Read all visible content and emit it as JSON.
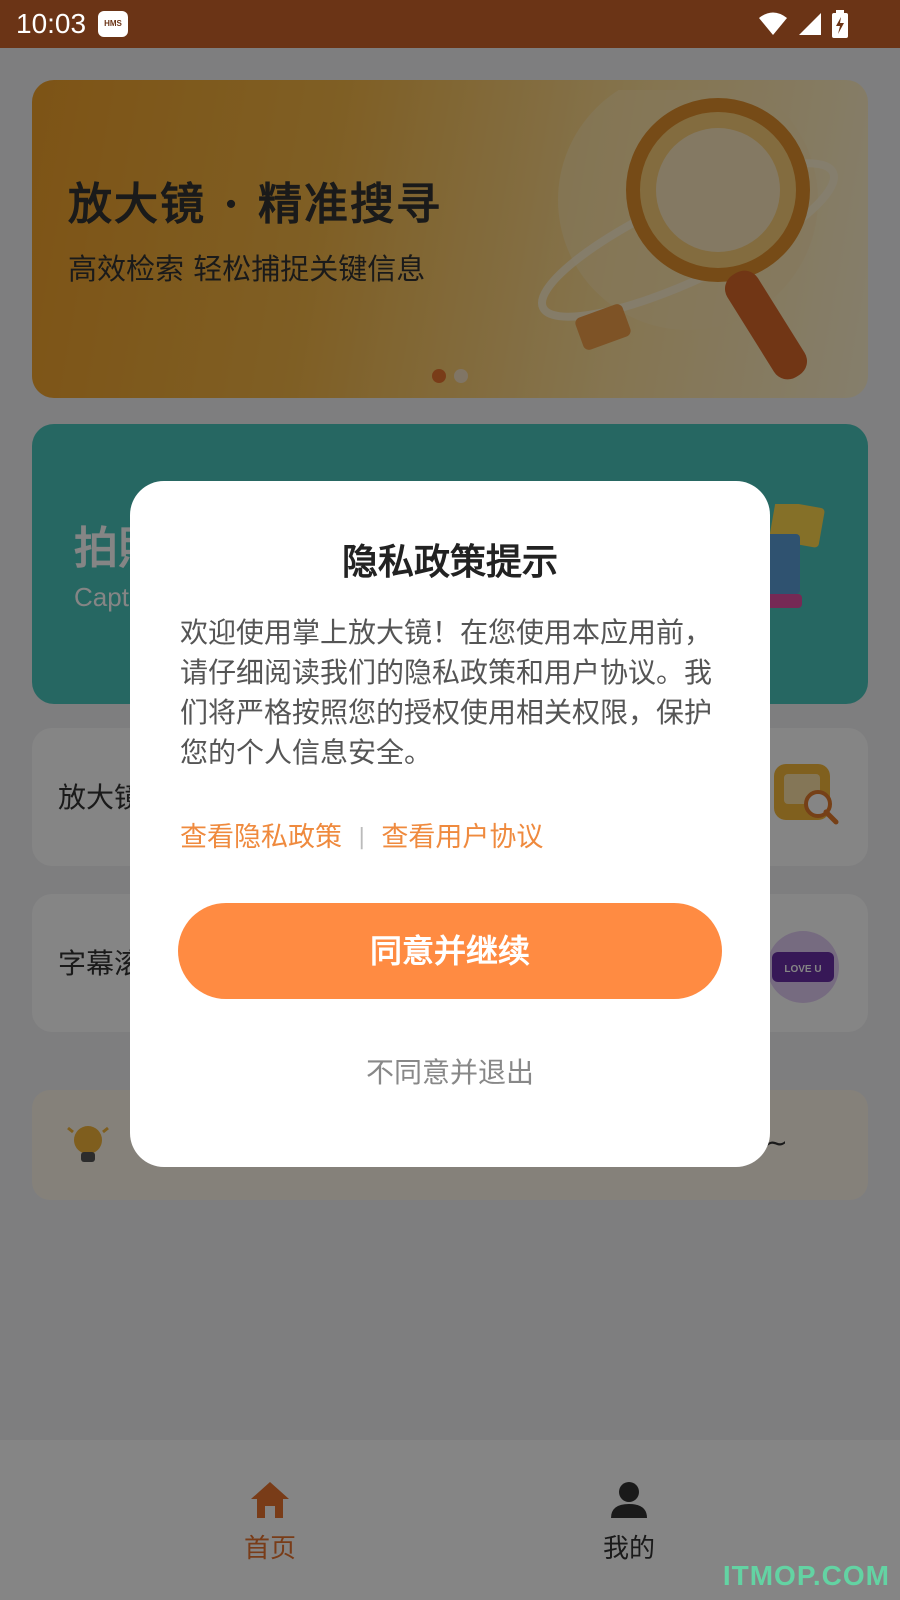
{
  "status_bar": {
    "time": "10:03",
    "badge": "HMS"
  },
  "banner": {
    "title": "放大镜 · 精准搜寻",
    "subtitle": "高效检索 轻松捕捉关键信息",
    "active_dot_color": "#e8742e"
  },
  "teal_card": {
    "title": "拍照",
    "subtitle": "Capt"
  },
  "tools": [
    {
      "label": "放大镜",
      "icon": "magnifier-photo-icon"
    },
    {
      "label": "字幕滚",
      "icon": "love-u-neon-icon"
    }
  ],
  "tip": {
    "tail": "~",
    "icon": "lightbulb-icon"
  },
  "tabs": [
    {
      "label": "首页",
      "icon": "home-icon",
      "active": true
    },
    {
      "label": "我的",
      "icon": "person-icon",
      "active": false
    }
  ],
  "dialog": {
    "title": "隐私政策提示",
    "body": "欢迎使用掌上放大镜！在您使用本应用前，请仔细阅读我们的隐私政策和用户协议。我们将严格按照您的授权使用相关权限，保护您的个人信息安全。",
    "privacy_link": "查看隐私政策",
    "separator": "|",
    "terms_link": "查看用户协议",
    "agree_label": "同意并继续",
    "decline_label": "不同意并退出"
  },
  "watermark": "ITMOP.COM",
  "colors": {
    "accent": "#ff8b42",
    "link": "#ef8a3e",
    "status_bar": "#6b3416",
    "teal": "#49c6bc"
  }
}
